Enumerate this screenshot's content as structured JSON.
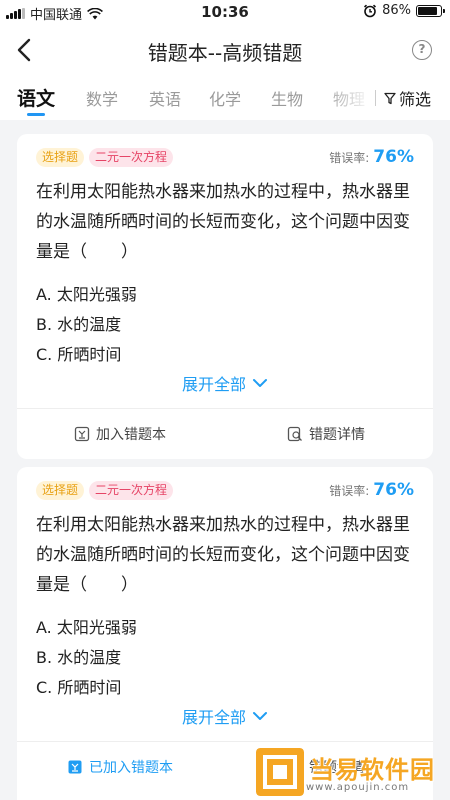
{
  "status_bar": {
    "carrier": "中国联通",
    "time": "10:36",
    "battery": "86%",
    "battery_level": 0.86
  },
  "header": {
    "title": "错题本--高频错题",
    "help_label": "?"
  },
  "tabs": {
    "items": [
      {
        "label": "语文",
        "active": true
      },
      {
        "label": "数学"
      },
      {
        "label": "英语"
      },
      {
        "label": "化学"
      },
      {
        "label": "生物"
      },
      {
        "label": "物理"
      }
    ],
    "filter_label": "筛选"
  },
  "cards": [
    {
      "type_tag": "选择题",
      "topic_tag": "二元一次方程",
      "rate_label": "错误率:",
      "rate_value": "76%",
      "question": "在利用太阳能热水器来加热水的过程中，热水器里的水温随所晒时间的长短而变化，这个问题中因变量是（　　）",
      "options": [
        "A. 太阳光强弱",
        "B. 水的温度",
        "C. 所晒时间"
      ],
      "expand_label": "展开全部",
      "action_left": "加入错题本",
      "action_right": "错题详情"
    },
    {
      "type_tag": "选择题",
      "topic_tag": "二元一次方程",
      "rate_label": "错误率:",
      "rate_value": "76%",
      "question": "在利用太阳能热水器来加热水的过程中，热水器里的水温随所晒时间的长短而变化，这个问题中因变量是（　　）",
      "options": [
        "A. 太阳光强弱",
        "B. 水的温度",
        "C. 所晒时间"
      ],
      "expand_label": "展开全部",
      "action_left": "已加入错题本",
      "action_right": "错题详情"
    }
  ],
  "watermark": {
    "name": "当易软件园",
    "url": "www.apoujin.com"
  },
  "colors": {
    "accent": "#1f9df3",
    "tag_type": "#e8a215",
    "tag_topic": "#e64466",
    "watermark": "#f5a623"
  }
}
